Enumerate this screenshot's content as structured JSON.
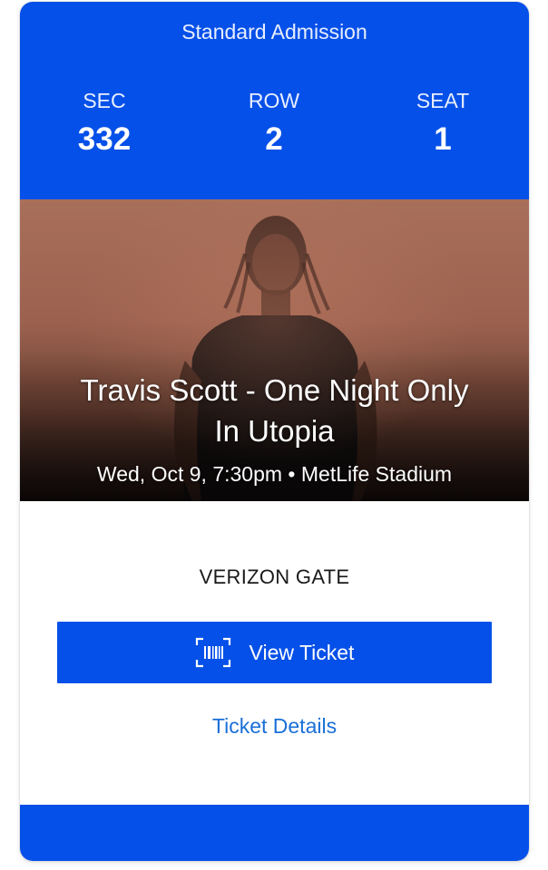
{
  "ticket": {
    "admission_type": "Standard Admission",
    "section_label": "SEC",
    "section_value": "332",
    "row_label": "ROW",
    "row_value": "2",
    "seat_label": "SEAT",
    "seat_value": "1"
  },
  "event": {
    "title_line1": "Travis Scott - One Night Only",
    "title_line2": "In Utopia",
    "datetime_venue": "Wed, Oct 9, 7:30pm • MetLife Stadium"
  },
  "entry": {
    "gate": "VERIZON GATE"
  },
  "actions": {
    "view_ticket_label": "View Ticket",
    "view_ticket_icon": "barcode-icon",
    "ticket_details_label": "Ticket Details"
  },
  "colors": {
    "brand_blue": "#0550e8",
    "link_blue": "#1a6fd8"
  }
}
